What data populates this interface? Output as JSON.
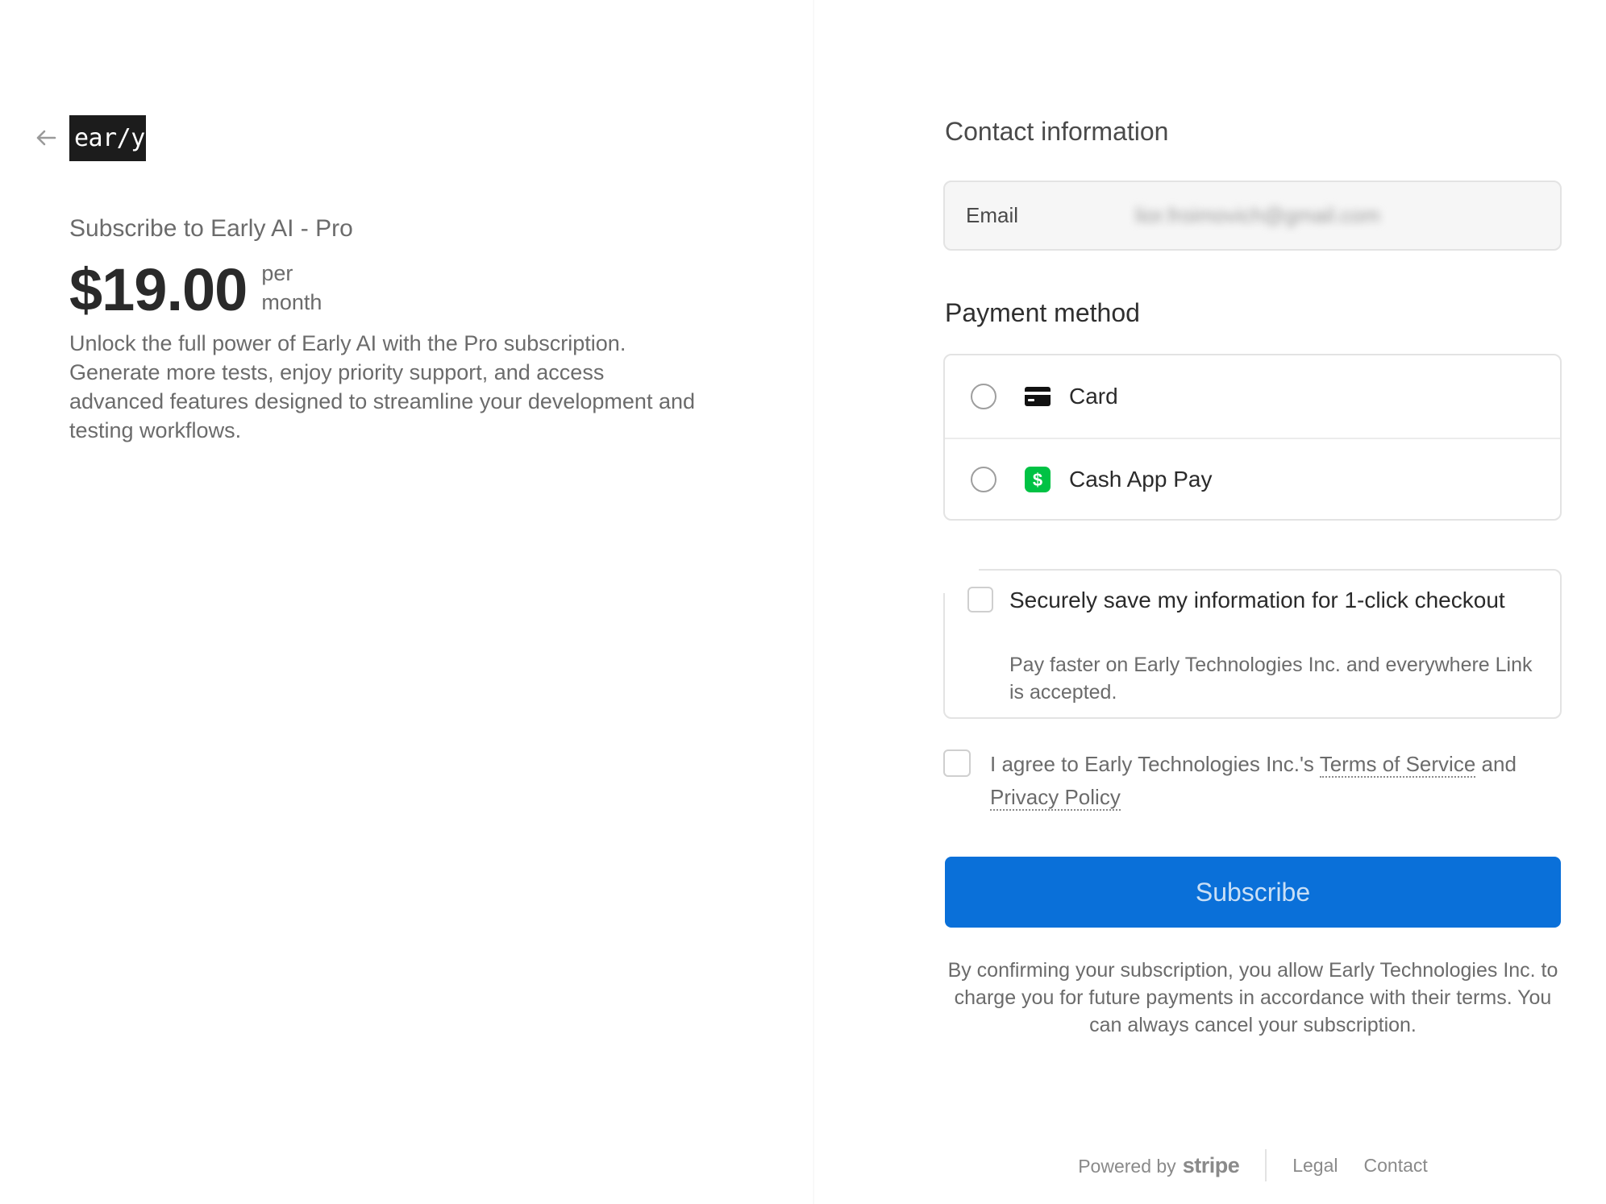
{
  "left": {
    "logo_text": "ear/y",
    "product_name": "Subscribe to Early AI - Pro",
    "price": "$19.00",
    "interval_line1": "per",
    "interval_line2": "month",
    "description": "Unlock the full power of Early AI with the Pro subscription. Generate more tests, enjoy priority support, and access advanced features designed to streamline your development and testing workflows."
  },
  "contact": {
    "title": "Contact information",
    "email_label": "Email",
    "email_value": "lior.froimovich@gmail.com"
  },
  "payment": {
    "title": "Payment method",
    "methods": [
      {
        "label": "Card",
        "icon": "card-icon"
      },
      {
        "label": "Cash App Pay",
        "icon": "cash-app-icon"
      }
    ]
  },
  "save_info": {
    "title": "Securely save my information for 1-click checkout",
    "description": "Pay faster on Early Technologies Inc. and everywhere Link is accepted."
  },
  "terms": {
    "prefix": "I agree to Early Technologies Inc.'s ",
    "tos_link": "Terms of Service",
    "middle": " and",
    "privacy_link": "Privacy Policy"
  },
  "subscribe_label": "Subscribe",
  "confirm_text": "By confirming your subscription, you allow Early Technologies Inc. to charge you for future payments in accordance with their terms. You can always cancel your subscription.",
  "footer": {
    "powered_by": "Powered by",
    "stripe": "stripe",
    "legal": "Legal",
    "contact": "Contact"
  },
  "colors": {
    "subscribe_button": "#0a70d9",
    "cash_app_green": "#00c244",
    "logo_background": "#1c1c1c"
  }
}
